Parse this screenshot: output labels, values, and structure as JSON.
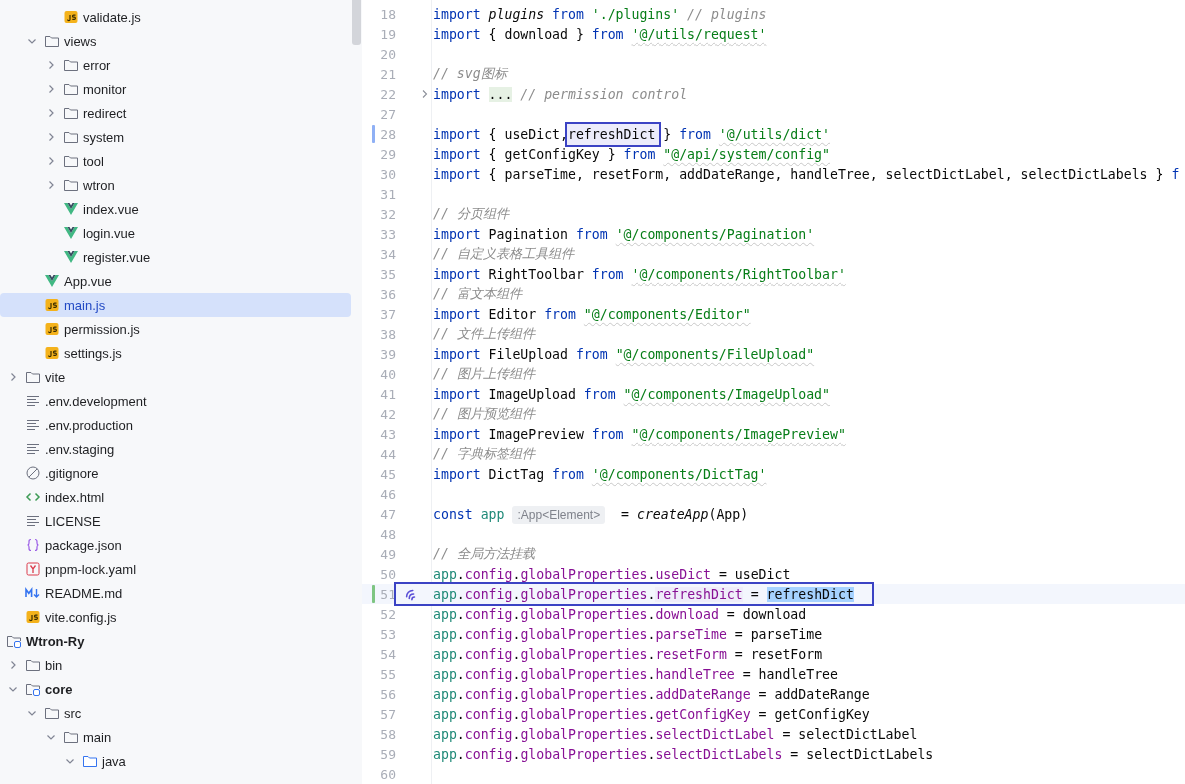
{
  "tree": [
    {
      "children": [
        {
          "children": [
            {
              "children": [
                {
                  "name": "validate.js",
                  "kind": "js",
                  "selected": false
                }
              ]
            },
            {
              "name": "views",
              "kind": "folder",
              "expanded": true,
              "selected": false,
              "children": [
                {
                  "name": "error",
                  "kind": "folder",
                  "expanded": false,
                  "selected": false
                },
                {
                  "name": "monitor",
                  "kind": "folder",
                  "expanded": false,
                  "selected": false
                },
                {
                  "name": "redirect",
                  "kind": "folder",
                  "expanded": false,
                  "selected": false
                },
                {
                  "name": "system",
                  "kind": "folder",
                  "expanded": false,
                  "selected": false
                },
                {
                  "name": "tool",
                  "kind": "folder",
                  "expanded": false,
                  "selected": false
                },
                {
                  "name": "wtron",
                  "kind": "folder",
                  "expanded": false,
                  "selected": false
                },
                {
                  "name": "index.vue",
                  "kind": "vue",
                  "selected": false
                },
                {
                  "name": "login.vue",
                  "kind": "vue",
                  "selected": false
                },
                {
                  "name": "register.vue",
                  "kind": "vue",
                  "selected": false
                }
              ]
            },
            {
              "name": "App.vue",
              "kind": "vue",
              "selected": false
            },
            {
              "name": "main.js",
              "kind": "js",
              "selected": true
            },
            {
              "name": "permission.js",
              "kind": "js",
              "selected": false
            },
            {
              "name": "settings.js",
              "kind": "js",
              "selected": false
            }
          ]
        },
        {
          "name": "vite",
          "kind": "folder",
          "expanded": false,
          "selected": false
        },
        {
          "name": ".env.development",
          "kind": "text",
          "selected": false
        },
        {
          "name": ".env.production",
          "kind": "text",
          "selected": false
        },
        {
          "name": ".env.staging",
          "kind": "text",
          "selected": false
        },
        {
          "name": ".gitignore",
          "kind": "ignore",
          "selected": false
        },
        {
          "name": "index.html",
          "kind": "html",
          "selected": false
        },
        {
          "name": "LICENSE",
          "kind": "text",
          "selected": false
        },
        {
          "name": "package.json",
          "kind": "json",
          "selected": false
        },
        {
          "name": "pnpm-lock.yaml",
          "kind": "yaml",
          "selected": false
        },
        {
          "name": "README.md",
          "kind": "markdown",
          "selected": false
        },
        {
          "name": "vite.config.js",
          "kind": "js",
          "selected": false
        }
      ]
    },
    {
      "name": "Wtron-Ry",
      "kind": "module",
      "selected": false,
      "children": [
        {
          "name": "bin",
          "kind": "folder",
          "expanded": false,
          "selected": false
        },
        {
          "name": "core",
          "kind": "module",
          "expanded": true,
          "selected": false,
          "children": [
            {
              "name": "src",
              "kind": "folder",
              "expanded": true,
              "selected": false,
              "children": [
                {
                  "name": "main",
                  "kind": "folder",
                  "expanded": true,
                  "selected": false,
                  "children": [
                    {
                      "name": "java",
                      "kind": "sources",
                      "expanded": true,
                      "selected": false
                    }
                  ]
                }
              ]
            }
          ]
        }
      ]
    }
  ],
  "editor": {
    "lines": [
      {
        "number": "18",
        "current": false,
        "outlined": false,
        "tokens": [
          {
            "kind": "keyword",
            "text": "import "
          },
          {
            "kind": "italic",
            "text": "plugins"
          },
          {
            "kind": "keyword",
            "text": " from "
          },
          {
            "kind": "string",
            "text": "'./plugins'"
          },
          {
            "kind": "comment",
            "text": " // plugins"
          }
        ]
      },
      {
        "number": "19",
        "current": false,
        "outlined": false,
        "tokens": [
          {
            "kind": "keyword",
            "text": "import "
          },
          {
            "kind": "plain",
            "text": "{ download } "
          },
          {
            "kind": "keyword",
            "text": "from "
          },
          {
            "kind": "flagged",
            "text": "'@/utils/request'"
          }
        ]
      },
      {
        "number": "20",
        "current": false,
        "outlined": false
      },
      {
        "number": "21",
        "current": false,
        "outlined": false,
        "tokens": [
          {
            "kind": "comment",
            "text": "// svg图标"
          }
        ]
      },
      {
        "number": "22",
        "current": false,
        "outlined": false,
        "fold": {
          "kind": "collapsed"
        },
        "tokens": [
          {
            "kind": "keyword",
            "text": "import "
          },
          {
            "kind": "fold",
            "text": "..."
          },
          {
            "kind": "comment",
            "text": " // permission control"
          }
        ]
      },
      {
        "number": "27",
        "current": false,
        "outlined": false
      },
      {
        "number": "28",
        "current": false,
        "outlined": false,
        "change": {
          "kind": "modified"
        },
        "tokens": [
          {
            "kind": "keyword",
            "text": "import "
          },
          {
            "kind": "plain",
            "text": "{ useDict,"
          },
          {
            "kind": "boxed",
            "text": "refreshDict"
          },
          {
            "kind": "plain",
            "text": " } "
          },
          {
            "kind": "keyword",
            "text": "from "
          },
          {
            "kind": "flagged",
            "text": "'@/utils/dict'"
          }
        ]
      },
      {
        "number": "29",
        "current": false,
        "outlined": false,
        "tokens": [
          {
            "kind": "keyword",
            "text": "import "
          },
          {
            "kind": "plain",
            "text": "{ getConfigKey } "
          },
          {
            "kind": "keyword",
            "text": "from "
          },
          {
            "kind": "flagged",
            "text": "\"@/api/system/config\""
          }
        ]
      },
      {
        "number": "30",
        "current": false,
        "outlined": false,
        "tokens": [
          {
            "kind": "keyword",
            "text": "import "
          },
          {
            "kind": "plain",
            "text": "{ parseTime, resetForm, addDateRange, handleTree, selectDictLabel, selectDictLabels } "
          },
          {
            "kind": "keyword",
            "text": "f"
          }
        ]
      },
      {
        "number": "31",
        "current": false,
        "outlined": false
      },
      {
        "number": "32",
        "current": false,
        "outlined": false,
        "tokens": [
          {
            "kind": "comment",
            "text": "// 分页组件"
          }
        ]
      },
      {
        "number": "33",
        "current": false,
        "outlined": false,
        "tokens": [
          {
            "kind": "keyword",
            "text": "import "
          },
          {
            "kind": "plain",
            "text": "Pagination "
          },
          {
            "kind": "keyword",
            "text": "from "
          },
          {
            "kind": "flagged",
            "text": "'@/components/Pagination'"
          }
        ]
      },
      {
        "number": "34",
        "current": false,
        "outlined": false,
        "tokens": [
          {
            "kind": "comment",
            "text": "// 自定义表格工具组件"
          }
        ]
      },
      {
        "number": "35",
        "current": false,
        "outlined": false,
        "tokens": [
          {
            "kind": "keyword",
            "text": "import "
          },
          {
            "kind": "plain",
            "text": "RightToolbar "
          },
          {
            "kind": "keyword",
            "text": "from "
          },
          {
            "kind": "flagged",
            "text": "'@/components/RightToolbar'"
          }
        ]
      },
      {
        "number": "36",
        "current": false,
        "outlined": false,
        "tokens": [
          {
            "kind": "comment",
            "text": "// 富文本组件"
          }
        ]
      },
      {
        "number": "37",
        "current": false,
        "outlined": false,
        "tokens": [
          {
            "kind": "keyword",
            "text": "import "
          },
          {
            "kind": "plain",
            "text": "Editor "
          },
          {
            "kind": "keyword",
            "text": "from "
          },
          {
            "kind": "flagged",
            "text": "\"@/components/Editor\""
          }
        ]
      },
      {
        "number": "38",
        "current": false,
        "outlined": false,
        "tokens": [
          {
            "kind": "comment",
            "text": "// 文件上传组件"
          }
        ]
      },
      {
        "number": "39",
        "current": false,
        "outlined": false,
        "tokens": [
          {
            "kind": "keyword",
            "text": "import "
          },
          {
            "kind": "plain",
            "text": "FileUpload "
          },
          {
            "kind": "keyword",
            "text": "from "
          },
          {
            "kind": "flagged",
            "text": "\"@/components/FileUpload\""
          }
        ]
      },
      {
        "number": "40",
        "current": false,
        "outlined": false,
        "tokens": [
          {
            "kind": "comment",
            "text": "// 图片上传组件"
          }
        ]
      },
      {
        "number": "41",
        "current": false,
        "outlined": false,
        "tokens": [
          {
            "kind": "keyword",
            "text": "import "
          },
          {
            "kind": "plain",
            "text": "ImageUpload "
          },
          {
            "kind": "keyword",
            "text": "from "
          },
          {
            "kind": "flagged",
            "text": "\"@/components/ImageUpload\""
          }
        ]
      },
      {
        "number": "42",
        "current": false,
        "outlined": false,
        "tokens": [
          {
            "kind": "comment",
            "text": "// 图片预览组件"
          }
        ]
      },
      {
        "number": "43",
        "current": false,
        "outlined": false,
        "tokens": [
          {
            "kind": "keyword",
            "text": "import "
          },
          {
            "kind": "plain",
            "text": "ImagePreview "
          },
          {
            "kind": "keyword",
            "text": "from "
          },
          {
            "kind": "flagged",
            "text": "\"@/components/ImagePreview\""
          }
        ]
      },
      {
        "number": "44",
        "current": false,
        "outlined": false,
        "tokens": [
          {
            "kind": "comment",
            "text": "// 字典标签组件"
          }
        ]
      },
      {
        "number": "45",
        "current": false,
        "outlined": false,
        "tokens": [
          {
            "kind": "keyword",
            "text": "import "
          },
          {
            "kind": "plain",
            "text": "DictTag "
          },
          {
            "kind": "keyword",
            "text": "from "
          },
          {
            "kind": "flagged",
            "text": "'@/components/DictTag'"
          }
        ]
      },
      {
        "number": "46",
        "current": false,
        "outlined": false
      },
      {
        "number": "47",
        "current": false,
        "outlined": false,
        "tokens": [
          {
            "kind": "keyword",
            "text": "const "
          },
          {
            "kind": "variable",
            "text": "app"
          },
          {
            "kind": "hint",
            "text": ":App<Element>"
          },
          {
            "kind": "plain",
            "text": "  = "
          },
          {
            "kind": "italic",
            "text": "createApp"
          },
          {
            "kind": "plain",
            "text": "(App)"
          }
        ]
      },
      {
        "number": "48",
        "current": false,
        "outlined": false
      },
      {
        "number": "49",
        "current": false,
        "outlined": false,
        "tokens": [
          {
            "kind": "comment",
            "text": "// 全局方法挂载"
          }
        ]
      },
      {
        "number": "50",
        "current": false,
        "outlined": false,
        "tokens": [
          {
            "kind": "variable",
            "text": "app"
          },
          {
            "kind": "plain",
            "text": "."
          },
          {
            "kind": "member",
            "text": "config"
          },
          {
            "kind": "plain",
            "text": "."
          },
          {
            "kind": "member",
            "text": "globalProperties"
          },
          {
            "kind": "plain",
            "text": "."
          },
          {
            "kind": "member",
            "text": "useDict"
          },
          {
            "kind": "plain",
            "text": " = useDict"
          }
        ]
      },
      {
        "number": "51",
        "current": true,
        "outlined": true,
        "change": {
          "kind": "added"
        },
        "gutter_icon": {
          "kind": "assistant"
        },
        "tokens": [
          {
            "kind": "variable",
            "text": "app"
          },
          {
            "kind": "plain",
            "text": "."
          },
          {
            "kind": "member",
            "text": "config"
          },
          {
            "kind": "plain",
            "text": "."
          },
          {
            "kind": "member",
            "text": "globalProperties"
          },
          {
            "kind": "plain",
            "text": "."
          },
          {
            "kind": "usage",
            "text": "refreshDict"
          },
          {
            "kind": "plain",
            "text": " = "
          },
          {
            "kind": "selection",
            "text": "refreshDict"
          }
        ]
      },
      {
        "number": "52",
        "current": false,
        "outlined": false,
        "tokens": [
          {
            "kind": "variable",
            "text": "app"
          },
          {
            "kind": "plain",
            "text": "."
          },
          {
            "kind": "member",
            "text": "config"
          },
          {
            "kind": "plain",
            "text": "."
          },
          {
            "kind": "member",
            "text": "globalProperties"
          },
          {
            "kind": "plain",
            "text": "."
          },
          {
            "kind": "member",
            "text": "download"
          },
          {
            "kind": "plain",
            "text": " = download"
          }
        ]
      },
      {
        "number": "53",
        "current": false,
        "outlined": false,
        "tokens": [
          {
            "kind": "variable",
            "text": "app"
          },
          {
            "kind": "plain",
            "text": "."
          },
          {
            "kind": "member",
            "text": "config"
          },
          {
            "kind": "plain",
            "text": "."
          },
          {
            "kind": "member",
            "text": "globalProperties"
          },
          {
            "kind": "plain",
            "text": "."
          },
          {
            "kind": "member",
            "text": "parseTime"
          },
          {
            "kind": "plain",
            "text": " = parseTime"
          }
        ]
      },
      {
        "number": "54",
        "current": false,
        "outlined": false,
        "tokens": [
          {
            "kind": "variable",
            "text": "app"
          },
          {
            "kind": "plain",
            "text": "."
          },
          {
            "kind": "member",
            "text": "config"
          },
          {
            "kind": "plain",
            "text": "."
          },
          {
            "kind": "member",
            "text": "globalProperties"
          },
          {
            "kind": "plain",
            "text": "."
          },
          {
            "kind": "member",
            "text": "resetForm"
          },
          {
            "kind": "plain",
            "text": " = resetForm"
          }
        ]
      },
      {
        "number": "55",
        "current": false,
        "outlined": false,
        "tokens": [
          {
            "kind": "variable",
            "text": "app"
          },
          {
            "kind": "plain",
            "text": "."
          },
          {
            "kind": "member",
            "text": "config"
          },
          {
            "kind": "plain",
            "text": "."
          },
          {
            "kind": "member",
            "text": "globalProperties"
          },
          {
            "kind": "plain",
            "text": "."
          },
          {
            "kind": "member",
            "text": "handleTree"
          },
          {
            "kind": "plain",
            "text": " = handleTree"
          }
        ]
      },
      {
        "number": "56",
        "current": false,
        "outlined": false,
        "tokens": [
          {
            "kind": "variable",
            "text": "app"
          },
          {
            "kind": "plain",
            "text": "."
          },
          {
            "kind": "member",
            "text": "config"
          },
          {
            "kind": "plain",
            "text": "."
          },
          {
            "kind": "member",
            "text": "globalProperties"
          },
          {
            "kind": "plain",
            "text": "."
          },
          {
            "kind": "member",
            "text": "addDateRange"
          },
          {
            "kind": "plain",
            "text": " = addDateRange"
          }
        ]
      },
      {
        "number": "57",
        "current": false,
        "outlined": false,
        "tokens": [
          {
            "kind": "variable",
            "text": "app"
          },
          {
            "kind": "plain",
            "text": "."
          },
          {
            "kind": "member",
            "text": "config"
          },
          {
            "kind": "plain",
            "text": "."
          },
          {
            "kind": "member",
            "text": "globalProperties"
          },
          {
            "kind": "plain",
            "text": "."
          },
          {
            "kind": "member",
            "text": "getConfigKey"
          },
          {
            "kind": "plain",
            "text": " = getConfigKey"
          }
        ]
      },
      {
        "number": "58",
        "current": false,
        "outlined": false,
        "tokens": [
          {
            "kind": "variable",
            "text": "app"
          },
          {
            "kind": "plain",
            "text": "."
          },
          {
            "kind": "member",
            "text": "config"
          },
          {
            "kind": "plain",
            "text": "."
          },
          {
            "kind": "member",
            "text": "globalProperties"
          },
          {
            "kind": "plain",
            "text": "."
          },
          {
            "kind": "member",
            "text": "selectDictLabel"
          },
          {
            "kind": "plain",
            "text": " = selectDictLabel"
          }
        ]
      },
      {
        "number": "59",
        "current": false,
        "outlined": false,
        "tokens": [
          {
            "kind": "variable",
            "text": "app"
          },
          {
            "kind": "plain",
            "text": "."
          },
          {
            "kind": "member",
            "text": "config"
          },
          {
            "kind": "plain",
            "text": "."
          },
          {
            "kind": "member",
            "text": "globalProperties"
          },
          {
            "kind": "plain",
            "text": "."
          },
          {
            "kind": "member",
            "text": "selectDictLabels"
          },
          {
            "kind": "plain",
            "text": " = selectDictLabels"
          }
        ]
      },
      {
        "number": "60",
        "current": false,
        "outlined": false
      }
    ]
  }
}
